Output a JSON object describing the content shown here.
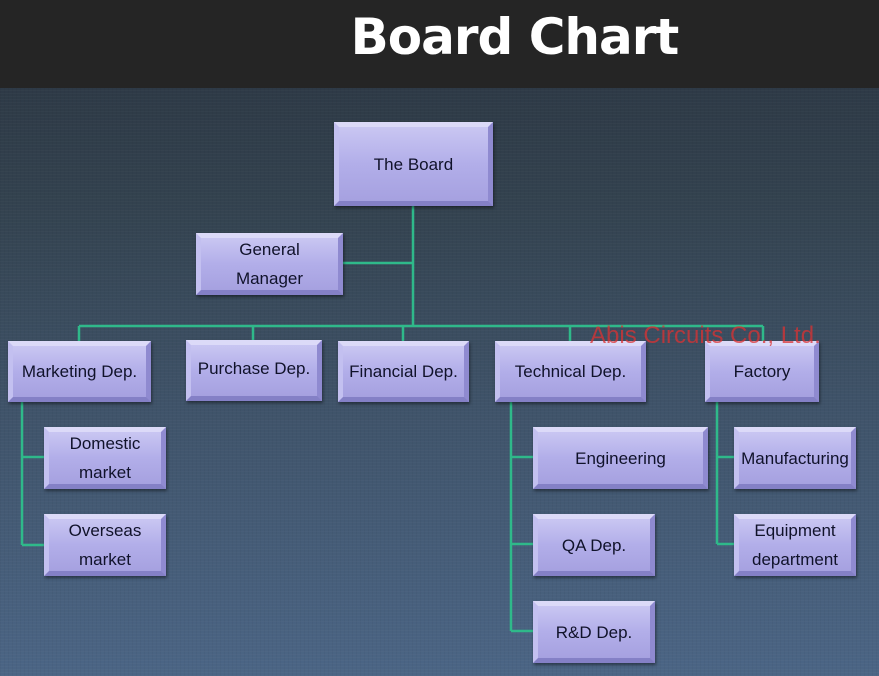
{
  "title": "Board Chart",
  "watermark": "Abis Circuits Co., Ltd.",
  "colors": {
    "header_bg": "#252525",
    "connector": "#2fb98a",
    "node_fill": "#b2aee9",
    "watermark": "#dc3232"
  },
  "nodes": {
    "board": "The Board",
    "general_manager": [
      "General",
      "Manager"
    ],
    "marketing": "Marketing Dep.",
    "purchase": "Purchase Dep.",
    "financial": "Financial Dep.",
    "technical": "Technical Dep.",
    "factory": "Factory",
    "domestic_market": [
      "Domestic",
      "market"
    ],
    "overseas_market": [
      "Overseas",
      "market"
    ],
    "engineering": "Engineering",
    "qa": "QA Dep.",
    "rnd": "R&D Dep.",
    "manufacturing": "Manufacturing",
    "equipment": [
      "Equipment",
      "department"
    ]
  },
  "hierarchy": {
    "The Board": [
      "General Manager",
      "Marketing Dep.",
      "Purchase Dep.",
      "Financial Dep.",
      "Technical Dep.",
      "Factory"
    ],
    "Marketing Dep.": [
      "Domestic market",
      "Overseas market"
    ],
    "Technical Dep.": [
      "Engineering",
      "QA Dep.",
      "R&D Dep."
    ],
    "Factory": [
      "Manufacturing",
      "Equipment department"
    ]
  }
}
